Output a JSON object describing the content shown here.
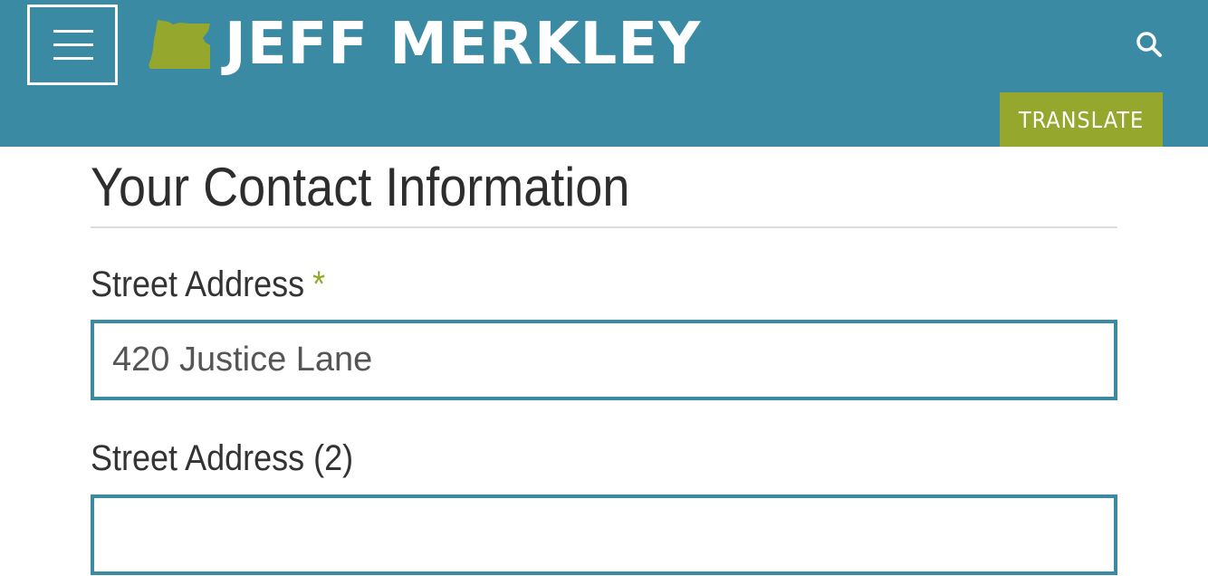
{
  "header": {
    "logo_text": "JEFF MERKLEY",
    "translate_label": "TRANSLATE",
    "colors": {
      "bar": "#3a8aa3",
      "accent": "#95a82d"
    },
    "icons": {
      "menu": "hamburger-menu-icon",
      "search": "search-icon",
      "logo": "oregon-state-icon"
    }
  },
  "form": {
    "section_title": "Your Contact Information",
    "fields": [
      {
        "label": "Street Address",
        "required_marker": "*",
        "value": "420 Justice Lane"
      },
      {
        "label": "Street Address (2)",
        "value": ""
      }
    ]
  }
}
